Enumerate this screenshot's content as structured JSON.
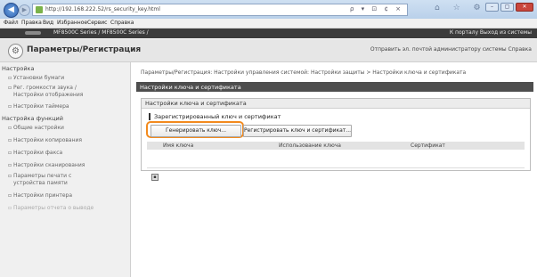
{
  "browser": {
    "address": "http://192.168.222.52/rs_security_key.html",
    "address_tools": "ρ ▾ ⊡ ¢ ×",
    "icons": "⌂ ☆ ⚙",
    "window_controls": [
      "–",
      "▢",
      "✕"
    ]
  },
  "menubar": [
    "Файл",
    "Правка",
    "Вид",
    "Избранное",
    "Сервис",
    "Справка"
  ],
  "brandbar": {
    "model": "MF8500C Series / MF8500C Series /",
    "links": "К порталу  Выход из системы"
  },
  "header": {
    "title": "Параметры/Регистрация",
    "links": "Отправить эл. почтой администратору системы  Справка"
  },
  "sidebar": {
    "groups": [
      {
        "label": "Настройка",
        "items": [
          [
            "Установки бумаги"
          ],
          [
            "Рег. громкости звука /",
            "Настройки отображения"
          ],
          [
            "Настройки таймера"
          ]
        ]
      },
      {
        "label": "Настройка функций",
        "items": [
          [
            "Общие настройки"
          ],
          [
            "Настройки копирования"
          ],
          [
            "Настройки факса"
          ],
          [
            "Настройки сканирования"
          ],
          [
            "Параметры печати с",
            "устройства памяти"
          ],
          [
            "Настройки принтера"
          ],
          [
            "Параметры отчета о выводе"
          ]
        ]
      }
    ]
  },
  "main": {
    "breadcrumb": "Параметры/Регистрация: Настройки управления системой: Настройки защиты > Настройки ключа и сертификата",
    "section_title": "Настройки ключа и сертификата",
    "panel_title": "Настройки ключа и сертификата",
    "subheading": "Зарегистрированный ключ и сертификат",
    "buttons": {
      "generate": "Генерировать ключ...",
      "register": "Регистрировать ключ и сертификат..."
    },
    "table_headers": [
      "Имя ключа",
      "Использование ключа",
      "Сертификат"
    ]
  }
}
